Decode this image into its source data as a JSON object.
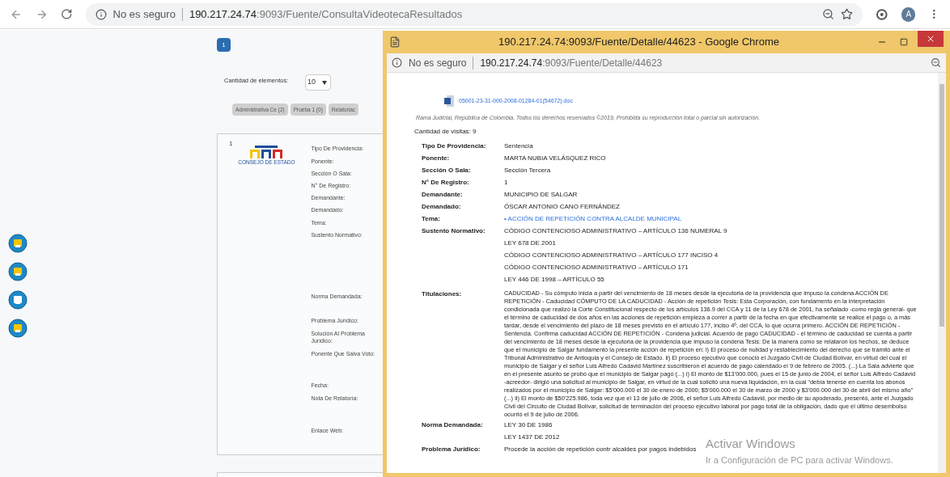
{
  "browser": {
    "security": "No es seguro",
    "url": {
      "host": "190.217.24.74",
      "path": ":9093/Fuente/ConsultaVideotecaResultados"
    },
    "profile_initial": "A"
  },
  "page": {
    "pagination": [
      {
        "label": "1",
        "selected": true
      }
    ],
    "page_size": {
      "label": "Cantidad de elementos:",
      "value": "10"
    },
    "filters": [
      {
        "label": "Administrativa Ce (2)"
      },
      {
        "label": "Prueba 1 (0)"
      },
      {
        "label": "Relatoriac"
      }
    ],
    "result": {
      "index": "1",
      "logo_text": "CONSEJO DE ESTADO",
      "labels": [
        "Tipo De Providencia:",
        "Ponente:",
        "Sección O Sala:",
        "N° De Registro:",
        "Demandante:",
        "Demandado:",
        "Tema:",
        "Sustento Normativo:",
        "Norma Demandada:",
        "Problema Jurídico:",
        "Solución Al Problema Jurídico:",
        "Ponente Que Salva Voto:",
        "Fecha:",
        "Nota De Relatoría:",
        "Enlace Web:"
      ]
    }
  },
  "popup": {
    "title": "190.217.24.74:9093/Fuente/Detalle/44623 - Google Chrome",
    "security": "No es seguro",
    "url": {
      "host": "190.217.24.74",
      "path": ":9093/Fuente/Detalle/44623"
    },
    "attachment": "05001-23-31-000-2008-01284-01(54672).doc",
    "copyright": "Rama Judicial, República de Colombia. Todos los derechos reservados ©2019, Prohibida su reproducción total o parcial sin autorización.",
    "visits": "Cantidad de visitas: 9",
    "fields": [
      {
        "label": "Tipo De Providencia:",
        "kind": "text",
        "values": [
          "Sentencia"
        ]
      },
      {
        "label": "Ponente:",
        "kind": "text",
        "values": [
          "MARTA NUBIA VELÁSQUEZ RICO"
        ]
      },
      {
        "label": "Sección O Sala:",
        "kind": "text",
        "values": [
          "Sección Tercera"
        ]
      },
      {
        "label": "N° De Registro:",
        "kind": "text",
        "values": [
          "1"
        ]
      },
      {
        "label": "Demandante:",
        "kind": "text",
        "values": [
          "MUNICIPIO DE SALGAR"
        ]
      },
      {
        "label": "Demandado:",
        "kind": "text",
        "values": [
          "ÓSCAR ANTONIO CANO FERNÁNDEZ"
        ]
      },
      {
        "label": "Tema:",
        "kind": "link",
        "values": [
          "• ACCIÓN DE REPETICIÓN CONTRA ALCALDE MUNICIPAL"
        ]
      },
      {
        "label": "Sustento Normativo:",
        "kind": "text",
        "values": [
          "CÓDIGO CONTENCIOSO ADMINISTRATIVO – ARTÍCULO 136 NUMERAL 9",
          "LEY 678 DE 2001",
          "CÓDIGO CONTENCIOSO ADMINISTRATIVO – ARTÍCULO 177 INCISO 4",
          "CÓDIGO CONTENCIOSO ADMINISTRATIVO – ARTÍCULO 171",
          "LEY 446 DE 1998 – ARTÍCULO 55"
        ]
      },
      {
        "label": "Titulaciones:",
        "kind": "paragraph",
        "values": [
          "CADUCIDAD - Su cómputo inicia a partir del vencimiento de 18 meses desde la ejecutoria de la providencia que impuso la condena ACCIÓN DE REPETICIÓN - Caducidad CÓMPUTO DE LA CADUCIDAD - Acción de repetición Tesis: Esta Corporación, con fundamento en la interpretación condicionada que realizó la Corte Constitucional respecto de los artículos 136.9 del CCA y 11 de la Ley 678 de 2001, ha señalado -como regla general- que el término de caducidad de dos años en las acciones de repetición empieza a correr a partir de la fecha en que efectivamente se realice el pago o, a más tardar, desde el vencimiento del plazo de 18 meses previsto en el artículo 177, inciso 4º, del CCA, lo que ocurra primero. ACCIÓN DE REPETICIÓN - Sentencia. Confirma caducidad ACCIÓN DE REPETICIÓN - Condena judicial. Acuerdo de pago CADUCIDAD - el término de caducidad se cuenta a partir del vencimiento de 18 meses desde la ejecutoria de la providencia que impuso la condena Tesis: De la manera como se relataron los hechos, se deduce que el municipio de Salgar fundamentó la presente acción de repetición en: i) El proceso de nulidad y restablecimiento del derecho que se tramitó ante el Tribunal Administrativo de Antioquia y el Consejo de Estado. ii) El proceso ejecutivo que conoció el Juzgado Civil de Ciudad Bolívar, en virtud del cual el municipio de Salgar y el señor Luis Alfredo Cadavid Martínez suscribieron el acuerdo de pago calendado el 9 de febrero de 2005. (...) La Sala advierte que en el presente asunto se probó que el municipio de Salgar pagó (...) i) El monto de $13'000.000, pues el 15 de junio de 2004, el señor Luis Alfredo Cadavid -acreedor- dirigió una solicitud al municipio de Salgar, en virtud de la cual solicitó una nueva liquidación, en la cual “debía tenerse en cuenta los abonos realizados por el municipio de Salgar: $5'000.000 el 30 de enero de 2000; $5'000.000 el 30 de marzo de 2000 y $3'000.000 del 30 de abril del mismo año” (...) ii) El monto de $50'225.986, toda vez que el 13 de julio de 2006, el señor Luis Alfredo Cadavid, por medio de su apoderado, presentó, ante el Juzgado Civil del Circuito de Ciudad Bolívar, solicitud de terminación del proceso ejecutivo laboral por pago total de la obligación, dado que el último desembolso ocurrió el 9 de julio de 2006."
        ]
      },
      {
        "label": "Norma Demandada:",
        "kind": "text",
        "values": [
          "LEY 30 DE 1986",
          "LEY 1437 DE 2012"
        ]
      },
      {
        "label": "Problema Jurídico:",
        "kind": "text",
        "values": [
          "Procede la acción de repetición contr alcaldes por pagos indebidos"
        ]
      }
    ]
  },
  "os_notice": {
    "title": "Activar Windows",
    "text": "Ir a Configuración de PC para activar Windows."
  }
}
